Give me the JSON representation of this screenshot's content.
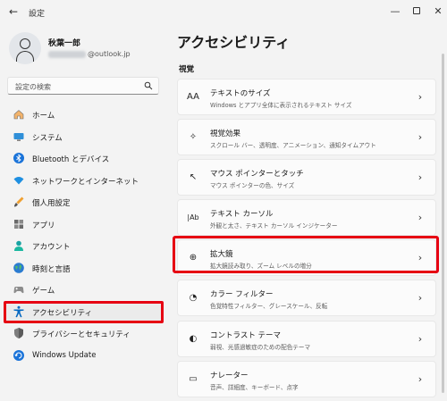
{
  "window": {
    "app_title": "設定",
    "back_glyph": "←",
    "minimize_glyph": "—",
    "close_glyph": "✕"
  },
  "profile": {
    "name": "秋葉一郎",
    "email_suffix": "@outlook.jp"
  },
  "search": {
    "placeholder": "設定の検索"
  },
  "sidebar": {
    "items": [
      {
        "label": "ホーム",
        "icon": "home-icon"
      },
      {
        "label": "システム",
        "icon": "monitor-icon"
      },
      {
        "label": "Bluetooth とデバイス",
        "icon": "bluetooth-icon"
      },
      {
        "label": "ネットワークとインターネット",
        "icon": "wifi-icon"
      },
      {
        "label": "個人用設定",
        "icon": "brush-icon"
      },
      {
        "label": "アプリ",
        "icon": "apps-icon"
      },
      {
        "label": "アカウント",
        "icon": "account-icon"
      },
      {
        "label": "時刻と言語",
        "icon": "globe-icon"
      },
      {
        "label": "ゲーム",
        "icon": "gamepad-icon"
      },
      {
        "label": "アクセシビリティ",
        "icon": "accessibility-icon",
        "active": true
      },
      {
        "label": "プライバシーとセキュリティ",
        "icon": "shield-icon"
      },
      {
        "label": "Windows Update",
        "icon": "update-icon"
      }
    ]
  },
  "main": {
    "title": "アクセシビリティ",
    "section": "視覚",
    "cards": [
      {
        "title": "テキストのサイズ",
        "subtitle": "Windows とアプリ全体に表示されるテキスト サイズ",
        "icon_glyph": "AA"
      },
      {
        "title": "視覚効果",
        "subtitle": "スクロール バー、透明度、アニメーション、通知タイムアウト",
        "icon_glyph": "✧"
      },
      {
        "title": "マウス ポインターとタッチ",
        "subtitle": "マウス ポインターの色、サイズ",
        "icon_glyph": "↖"
      },
      {
        "title": "テキスト カーソル",
        "subtitle": "外観と太さ、テキスト カーソル インジケーター",
        "icon_glyph": "|Ab"
      },
      {
        "title": "拡大鏡",
        "subtitle": "拡大鏡読み取り、ズーム レベルの増分",
        "icon_glyph": "⊕"
      },
      {
        "title": "カラー フィルター",
        "subtitle": "色覚特性フィルター、グレースケール、反転",
        "icon_glyph": "◔"
      },
      {
        "title": "コントラスト テーマ",
        "subtitle": "弱視、光感過敏症のための配色テーマ",
        "icon_glyph": "◐"
      },
      {
        "title": "ナレーター",
        "subtitle": "音声、詳細度、キーボード、点字",
        "icon_glyph": "▭"
      }
    ],
    "chevron": "›"
  },
  "colors": {
    "highlight": "#e60012",
    "accent": "#0067c0"
  }
}
